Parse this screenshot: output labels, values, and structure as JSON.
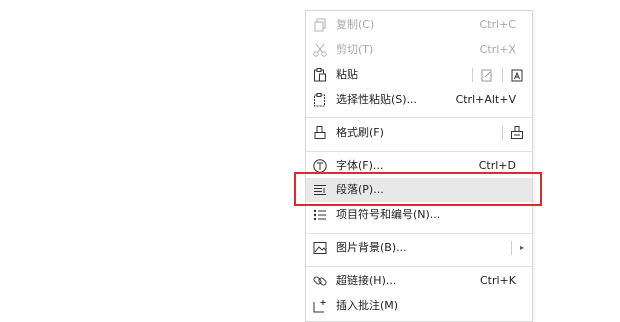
{
  "menu": {
    "copy": {
      "label": "复制(C)",
      "shortcut": "Ctrl+C"
    },
    "cut": {
      "label": "剪切(T)",
      "shortcut": "Ctrl+X"
    },
    "paste": {
      "label": "粘贴"
    },
    "paste_special": {
      "label": "选择性粘贴(S)...",
      "shortcut": "Ctrl+Alt+V"
    },
    "format_painter": {
      "label": "格式刷(F)"
    },
    "font": {
      "label": "字体(F)...",
      "shortcut": "Ctrl+D"
    },
    "paragraph": {
      "label": "段落(P)..."
    },
    "bullets": {
      "label": "项目符号和编号(N)..."
    },
    "background": {
      "label": "图片背景(B)..."
    },
    "hyperlink": {
      "label": "超链接(H)...",
      "shortcut": "Ctrl+K"
    },
    "comment": {
      "label": "插入批注(M)"
    }
  },
  "colors": {
    "highlight_box": "#e0282e",
    "disabled_text": "#a8a8a8"
  }
}
